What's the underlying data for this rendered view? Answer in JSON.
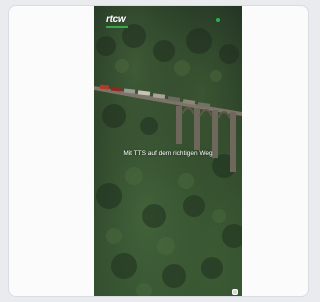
{
  "brand": {
    "logo_text": "rtcw",
    "accent": "#2fae4e"
  },
  "hero": {
    "headline": "Mit TTS auf dem richtigen Weg"
  },
  "icons": {
    "menu": "menu-dot-icon",
    "widget": "chat-widget-icon"
  }
}
